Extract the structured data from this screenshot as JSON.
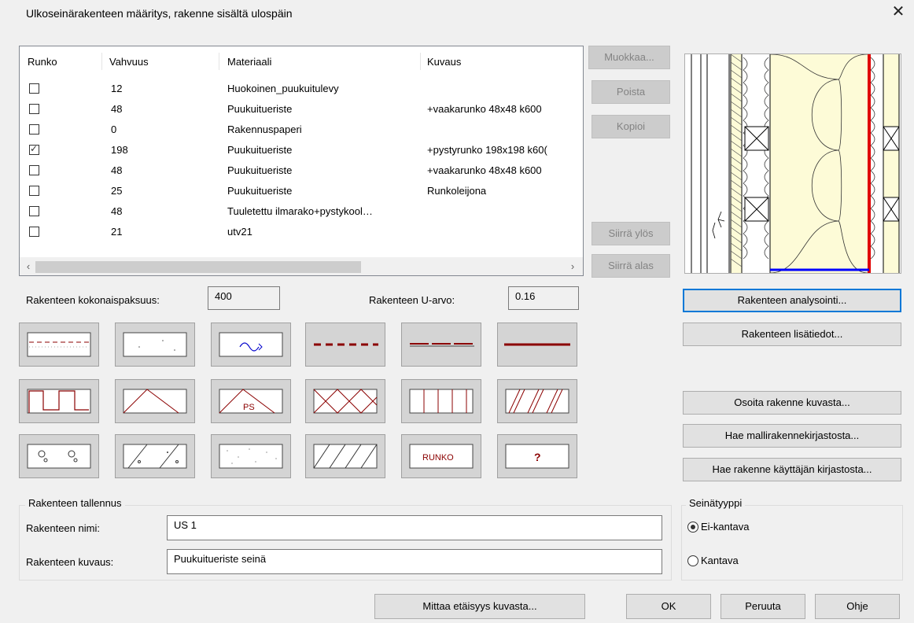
{
  "window": {
    "title": "Ulkoseinärakenteen määritys, rakenne sisältä ulospäin",
    "close_glyph": "✕"
  },
  "layers_table": {
    "headers": [
      "Runko",
      "Vahvuus",
      "Materiaali",
      "Kuvaus"
    ],
    "rows": [
      {
        "runko": false,
        "vahvuus": "12",
        "materiaali": "Huokoinen_puukuitulevy",
        "kuvaus": ""
      },
      {
        "runko": false,
        "vahvuus": "48",
        "materiaali": "Puukuitueriste",
        "kuvaus": "+vaakarunko 48x48 k600"
      },
      {
        "runko": false,
        "vahvuus": "0",
        "materiaali": "Rakennuspaperi",
        "kuvaus": ""
      },
      {
        "runko": true,
        "vahvuus": "198",
        "materiaali": "Puukuitueriste",
        "kuvaus": "+pystyrunko 198x198 k60("
      },
      {
        "runko": false,
        "vahvuus": "48",
        "materiaali": "Puukuitueriste",
        "kuvaus": "+vaakarunko 48x48 k600"
      },
      {
        "runko": false,
        "vahvuus": "25",
        "materiaali": "Puukuitueriste",
        "kuvaus": "Runkoleijona"
      },
      {
        "runko": false,
        "vahvuus": "48",
        "materiaali": "Tuuletettu ilmarako+pystykool…",
        "kuvaus": ""
      },
      {
        "runko": false,
        "vahvuus": "21",
        "materiaali": "utv21",
        "kuvaus": ""
      }
    ],
    "scroll_left": "‹",
    "scroll_right": "›"
  },
  "side_buttons": {
    "muokkaa": "Muokkaa...",
    "poista": "Poista",
    "kopioi": "Kopioi",
    "siirra_ylos": "Siirrä ylös",
    "siirra_alas": "Siirrä alas"
  },
  "totals": {
    "thickness_label": "Rakenteen kokonaispaksuus:",
    "thickness_value": "400",
    "u_label": "Rakenteen U-arvo:",
    "u_value": "0.16"
  },
  "material_tiles": {
    "ps_text": "PS",
    "runko_text": "RUNKO",
    "question_text": "?"
  },
  "right_buttons": {
    "analysointi": "Rakenteen analysointi...",
    "lisatiedot": "Rakenteen lisätiedot...",
    "osoita": "Osoita rakenne kuvasta...",
    "malli": "Hae mallirakennekirjastosta...",
    "kayttaja": "Hae rakenne käyttäjän kirjastosta..."
  },
  "save_group": {
    "title": "Rakenteen tallennus",
    "name_label": "Rakenteen nimi:",
    "name_value": "US 1",
    "desc_label": "Rakenteen kuvaus:",
    "desc_value": "Puukuitueriste seinä"
  },
  "wall_type": {
    "title": "Seinätyyppi",
    "options": [
      {
        "label": "Ei-kantava",
        "selected": true
      },
      {
        "label": "Kantava",
        "selected": false
      }
    ]
  },
  "bottom_buttons": {
    "mittaa": "Mittaa etäisyys kuvasta...",
    "ok": "OK",
    "peruuta": "Peruuta",
    "ohje": "Ohje"
  },
  "colors": {
    "accent": "#0078d7",
    "hatch": "#8b0000",
    "membrane": "#e00000",
    "base_line": "#0000ff",
    "insulation": "#fdfbd7"
  }
}
